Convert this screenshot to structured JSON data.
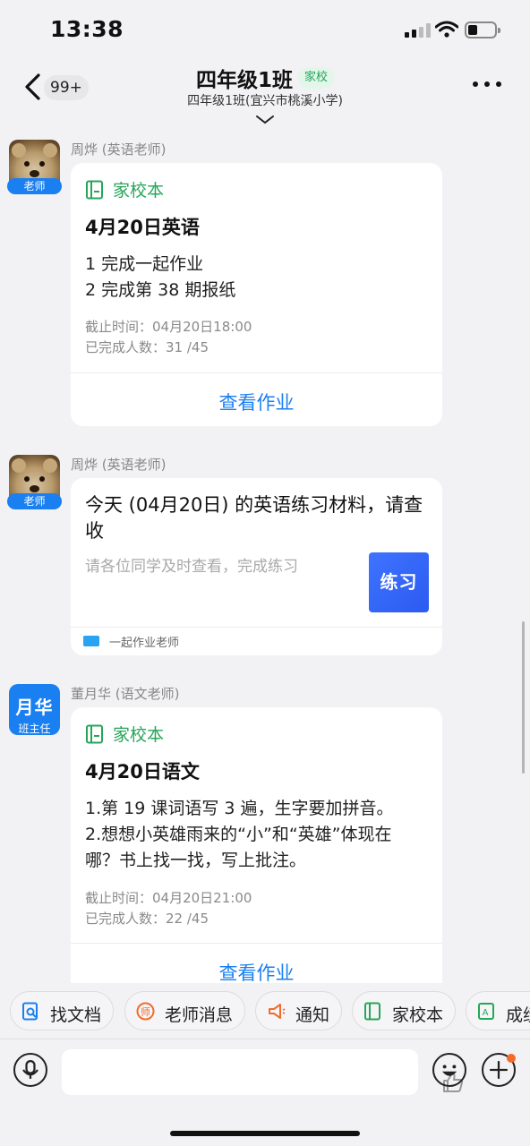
{
  "status_bar": {
    "time": "13:38"
  },
  "header": {
    "back_badge": "99+",
    "title": "四年级1班",
    "tag": "家校",
    "subtitle": "四年级1班(宜兴市桃溪小学)"
  },
  "messages": [
    {
      "sender": "周烨 (英语老师)",
      "role": "老师",
      "card_type": "家校本",
      "title": "4月20日英语",
      "lines": [
        "1 完成一起作业",
        "2 完成第 38 期报纸"
      ],
      "deadline": "截止时间：04月20日18:00",
      "completed": "已完成人数：31 /45",
      "action": "查看作业"
    },
    {
      "sender": "周烨 (英语老师)",
      "role": "老师",
      "title": "今天 (04月20日) 的英语练习材料，请查收",
      "desc": "请各位同学及时查看，完成练习",
      "thumb_text": "练习",
      "source": "一起作业老师"
    },
    {
      "sender": "董月华 (语文老师)",
      "avatar_text": "月华",
      "role": "班主任",
      "card_type": "家校本",
      "title": "4月20日语文",
      "lines": [
        "1.第 19 课词语写 3 遍，生字要加拼音。",
        "2.想想小英雄雨来的“小”和“英雄”体现在",
        "哪？书上找一找，写上批注。"
      ],
      "deadline": "截止时间：04月20日21:00",
      "completed": "已完成人数：22 /45",
      "action": "查看作业"
    }
  ],
  "quick_actions": [
    {
      "label": "找文档",
      "icon": "doc-search-icon",
      "color": "#1a7ff0"
    },
    {
      "label": "老师消息",
      "icon": "teacher-icon",
      "color": "#f36b2a"
    },
    {
      "label": "通知",
      "icon": "megaphone-icon",
      "color": "#f36b2a"
    },
    {
      "label": "家校本",
      "icon": "book-icon",
      "color": "#27a55a"
    },
    {
      "label": "成绩",
      "icon": "grade-icon",
      "color": "#27a55a"
    }
  ],
  "colors": {
    "accent_blue": "#1a7ff0",
    "green": "#27a55a",
    "orange": "#f36b2a"
  }
}
